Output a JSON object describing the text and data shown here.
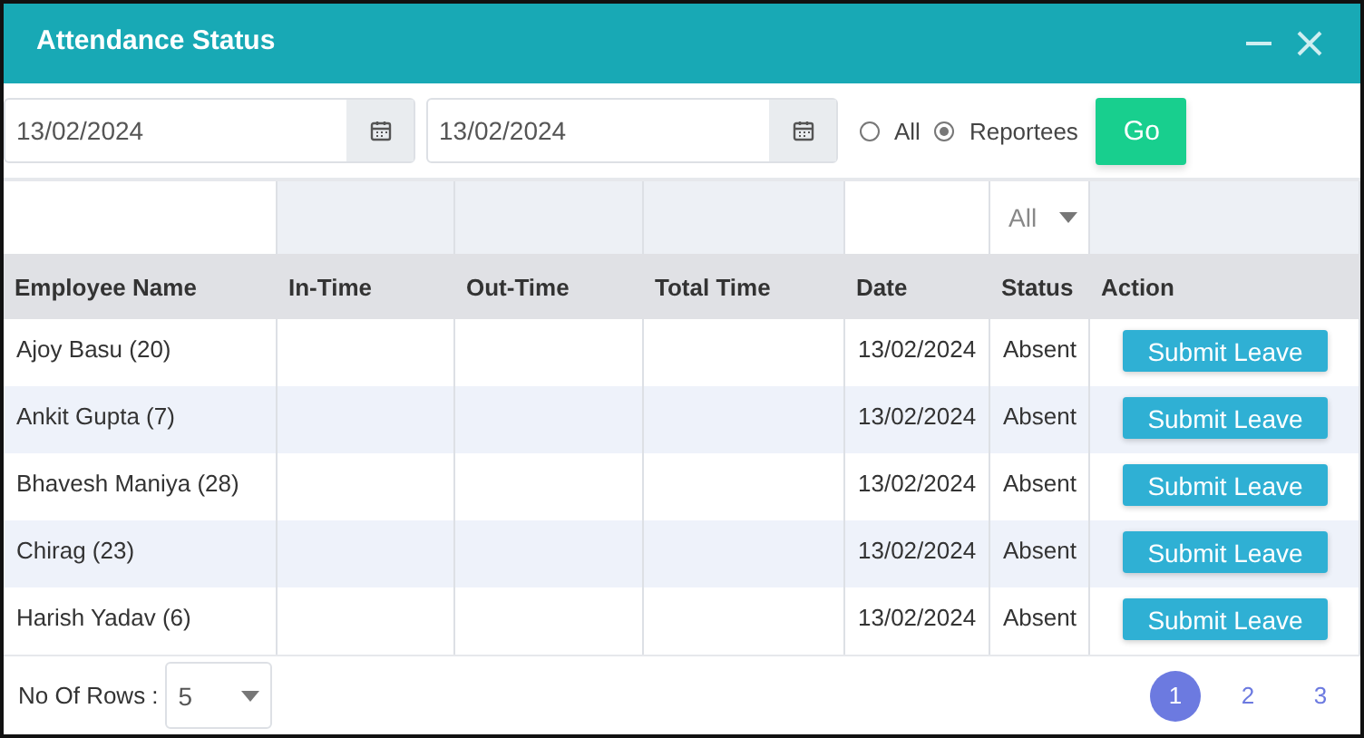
{
  "window": {
    "title": "Attendance Status"
  },
  "toolbar": {
    "from_date": "13/02/2024",
    "to_date": "13/02/2024",
    "scope_options": [
      {
        "label": "All",
        "selected": false
      },
      {
        "label": "Reportees",
        "selected": true
      }
    ],
    "go_button": "Go"
  },
  "table": {
    "filters": [
      {
        "kind": "input"
      },
      {
        "kind": "none"
      },
      {
        "kind": "none"
      },
      {
        "kind": "none"
      },
      {
        "kind": "input"
      },
      {
        "kind": "select",
        "value": "All"
      },
      {
        "kind": "none"
      }
    ],
    "columns": [
      "Employee Name",
      "In-Time",
      "Out-Time",
      "Total Time",
      "Date",
      "Status",
      "Action"
    ],
    "rows": [
      {
        "name": "Ajoy Basu (20)",
        "date": "13/02/2024",
        "status": "Absent",
        "action": "Submit Leave"
      },
      {
        "name": "Ankit Gupta (7)",
        "date": "13/02/2024",
        "status": "Absent",
        "action": "Submit Leave"
      },
      {
        "name": "Bhavesh Maniya (28)",
        "date": "13/02/2024",
        "status": "Absent",
        "action": "Submit Leave"
      },
      {
        "name": "Chirag (23)",
        "date": "13/02/2024",
        "status": "Absent",
        "action": "Submit Leave"
      },
      {
        "name": "Harish Yadav (6)",
        "date": "13/02/2024",
        "status": "Absent",
        "action": "Submit Leave"
      }
    ]
  },
  "footer": {
    "rows_label": "No Of Rows :",
    "rows_value": "5",
    "pages": [
      {
        "label": "1",
        "selected": true
      },
      {
        "label": "2",
        "selected": false
      },
      {
        "label": "3",
        "selected": false
      }
    ]
  }
}
